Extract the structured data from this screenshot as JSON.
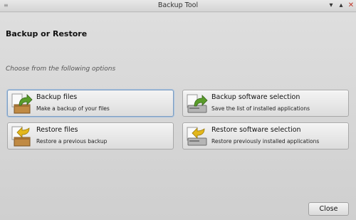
{
  "window": {
    "title": "Backup Tool",
    "menu_glyph": "≡",
    "minimize_glyph": "▾",
    "maximize_glyph": "▴",
    "close_glyph": "✕"
  },
  "page": {
    "heading": "Backup or Restore",
    "subheading": "Choose from the following options"
  },
  "options": [
    {
      "label": "Backup files",
      "description": "Make a backup of your files",
      "icon": "box-arrow-up-green-icon"
    },
    {
      "label": "Backup software selection",
      "description": "Save the list of installed applications",
      "icon": "drive-arrow-green-icon"
    },
    {
      "label": "Restore files",
      "description": "Restore a previous backup",
      "icon": "box-arrow-down-yellow-icon"
    },
    {
      "label": "Restore software selection",
      "description": "Restore previously installed applications",
      "icon": "drive-arrow-yellow-icon"
    }
  ],
  "footer": {
    "close_label": "Close"
  },
  "colors": {
    "green_arrow": "#5a9c2a",
    "yellow_arrow": "#e3b71b",
    "box": "#c08a43"
  }
}
